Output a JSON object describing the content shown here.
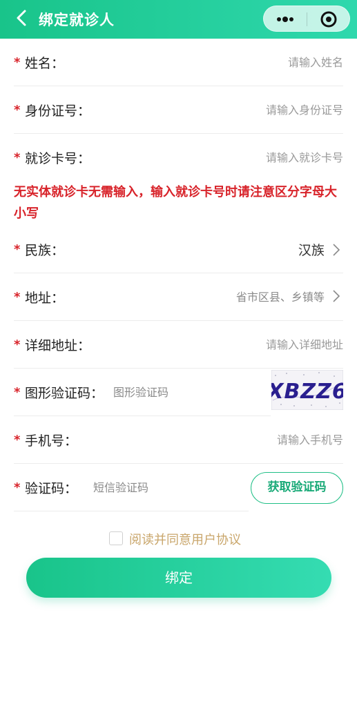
{
  "header": {
    "title": "绑定就诊人",
    "more_icon": "more-dots-icon",
    "close_icon": "target-close-icon"
  },
  "form": {
    "name": {
      "label": "姓名：",
      "placeholder": "请输入姓名"
    },
    "id_number": {
      "label": "身份证号：",
      "placeholder": "请输入身份证号"
    },
    "card_number": {
      "label": "就诊卡号：",
      "placeholder": "请输入就诊卡号"
    },
    "notice": "无实体就诊卡无需输入，输入就诊卡号时请注意区分字母大小写",
    "ethnicity": {
      "label": "民族：",
      "value": "汉族"
    },
    "address": {
      "label": "地址：",
      "placeholder": "省市区县、乡镇等"
    },
    "address_detail": {
      "label": "详细地址：",
      "placeholder": "请输入详细地址"
    },
    "captcha": {
      "label": "图形验证码：",
      "placeholder": "图形验证码",
      "image_text": "XBZZ6"
    },
    "phone": {
      "label": "手机号：",
      "placeholder": "请输入手机号"
    },
    "sms_code": {
      "label": "验证码：",
      "placeholder": "短信验证码",
      "button": "获取验证码"
    }
  },
  "agreement": {
    "text": "阅读并同意用户协议",
    "checked": false
  },
  "submit_label": "绑定",
  "colors": {
    "brand": "#1fc48c",
    "required": "#d8232a",
    "agreement": "#c9a66b"
  }
}
